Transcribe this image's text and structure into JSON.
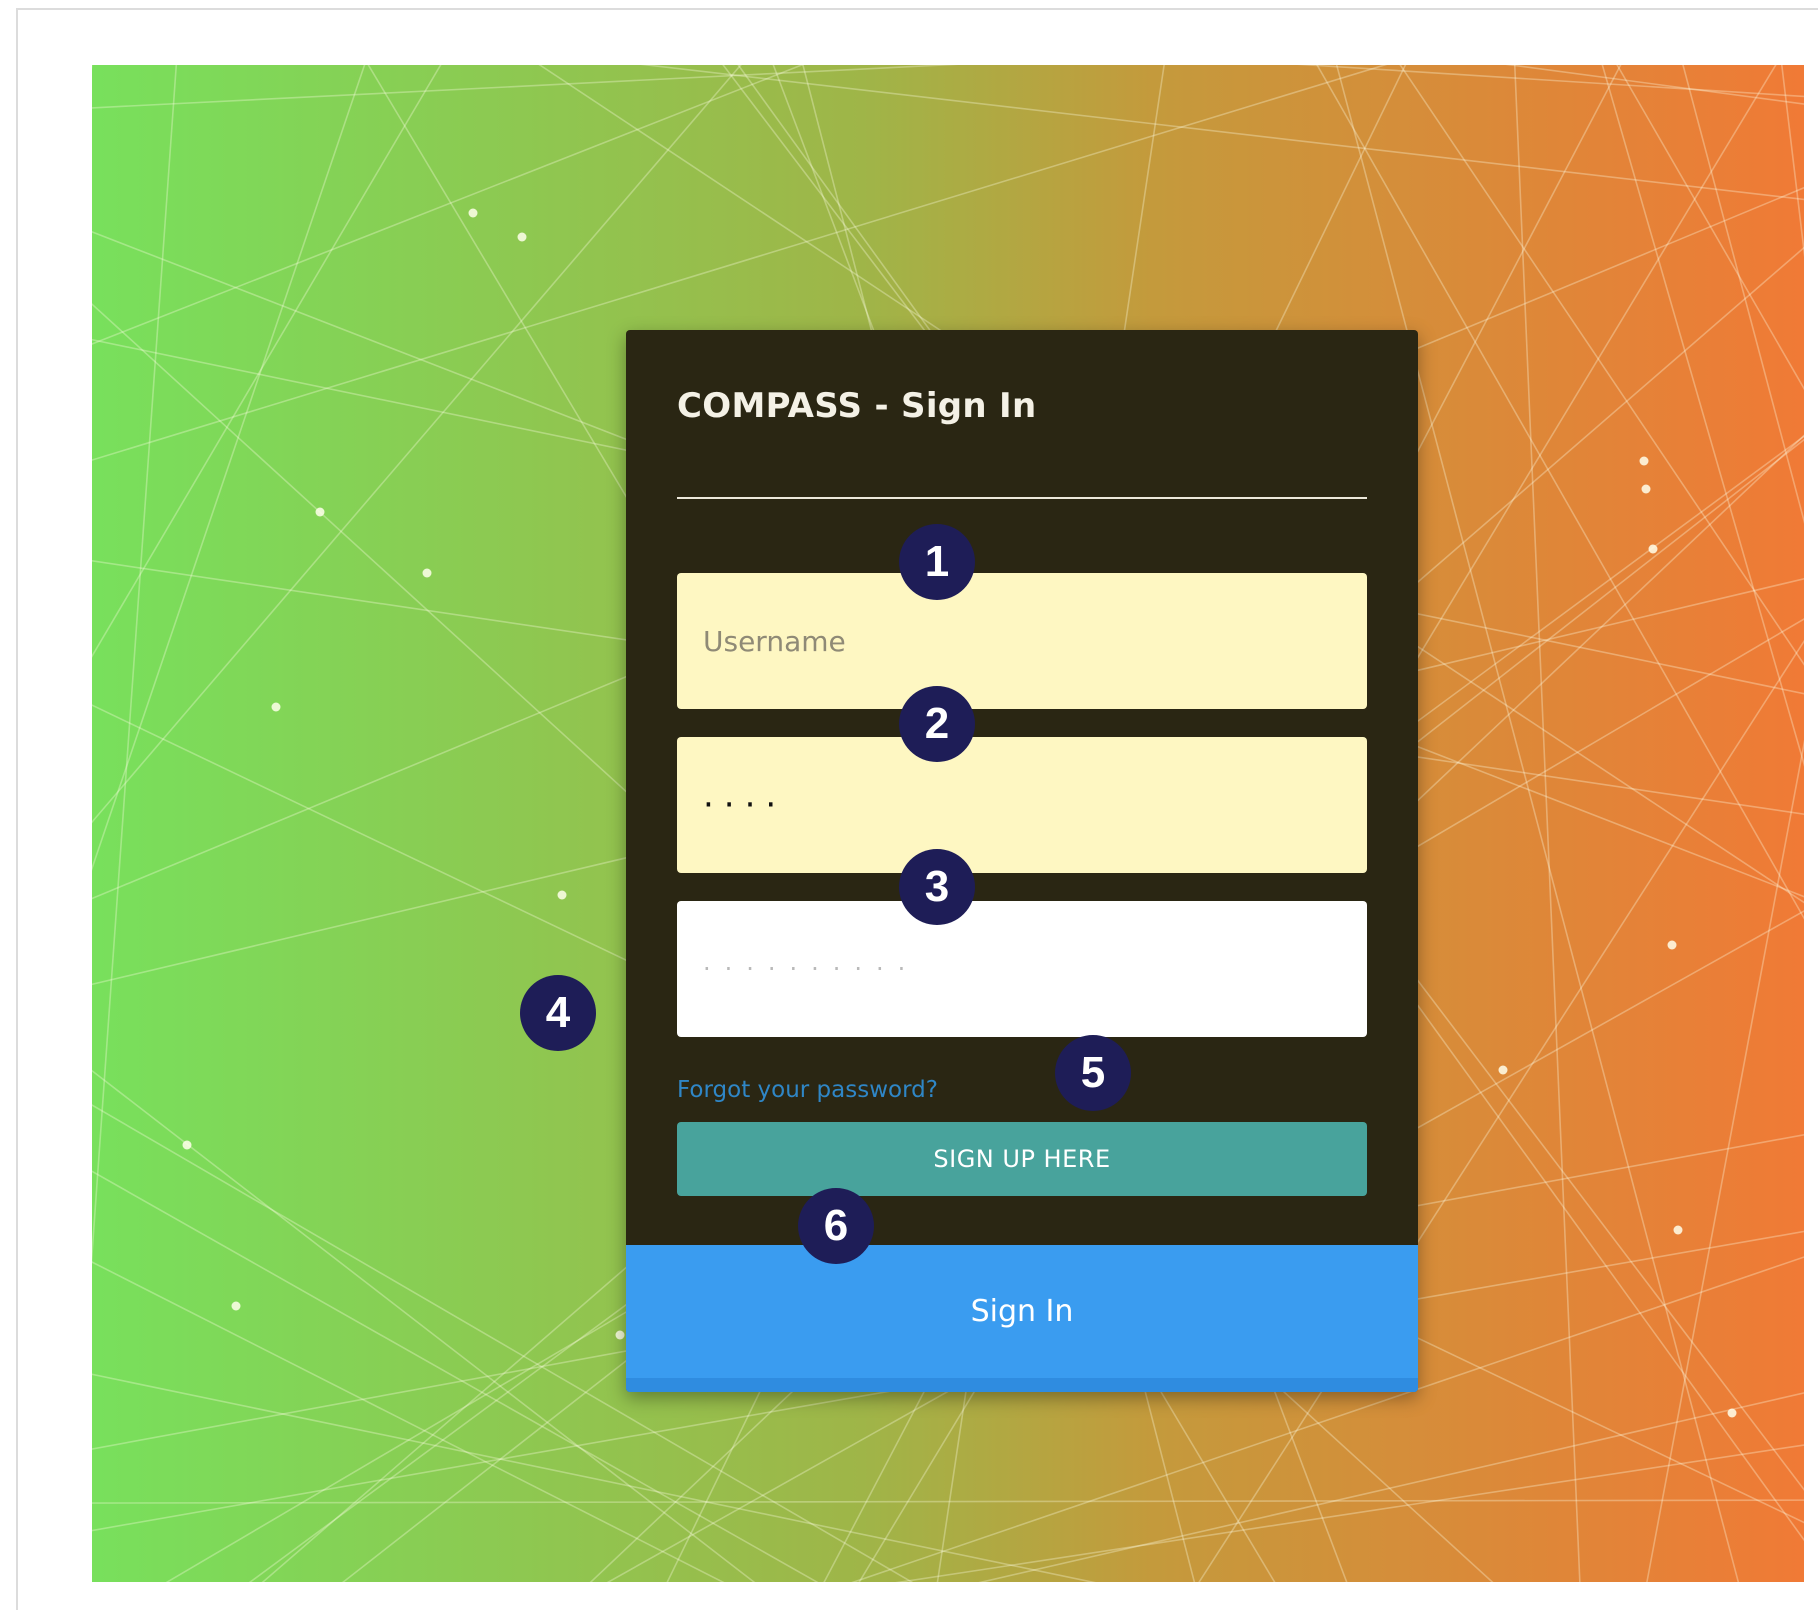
{
  "login": {
    "title": "COMPASS - Sign In",
    "username_placeholder": "Username",
    "password_value": "····",
    "confirm_placeholder": "··········",
    "forgot_link": "Forgot your password?",
    "signup_label": "SIGN UP HERE",
    "signin_label": "Sign In"
  },
  "annotations": [
    "1",
    "2",
    "3",
    "4",
    "5",
    "6"
  ],
  "colors": {
    "background_gradient_start": "#78e05c",
    "background_gradient_mid": "#a8a33e",
    "background_gradient_end": "#f07a36",
    "card_background": "#2a2613",
    "field_autofill": "#fef7c2",
    "link": "#2f86c6",
    "signup_button": "#48a39c",
    "signin_button": "#3a9cf0",
    "badge": "#1e1d57"
  }
}
